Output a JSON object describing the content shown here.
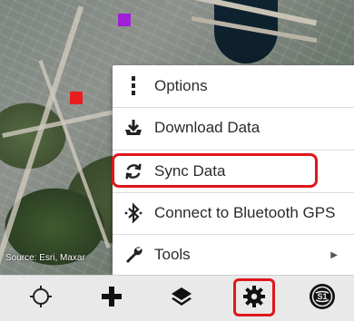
{
  "map": {
    "attribution": "Source: Esri, Maxar"
  },
  "menu": {
    "items": [
      {
        "label": "Options",
        "icon": "vertical-dots-icon"
      },
      {
        "label": "Download Data",
        "icon": "download-tray-icon"
      },
      {
        "label": "Sync Data",
        "icon": "sync-icon"
      },
      {
        "label": "Connect to Bluetooth GPS",
        "icon": "bluetooth-icon"
      },
      {
        "label": "Tools",
        "icon": "wrench-icon",
        "has_submenu": true
      }
    ]
  },
  "toolbar": {
    "buttons": [
      {
        "name": "locate",
        "icon": "crosshair-icon"
      },
      {
        "name": "add",
        "icon": "plus-icon"
      },
      {
        "name": "layers",
        "icon": "layers-icon"
      },
      {
        "name": "settings",
        "icon": "gear-icon"
      },
      {
        "name": "gps-status",
        "icon": "gps-logo-icon"
      }
    ]
  },
  "colors": {
    "highlight": "#e0161c",
    "marker_purple": "#a020d8",
    "marker_red": "#e81d1d"
  }
}
